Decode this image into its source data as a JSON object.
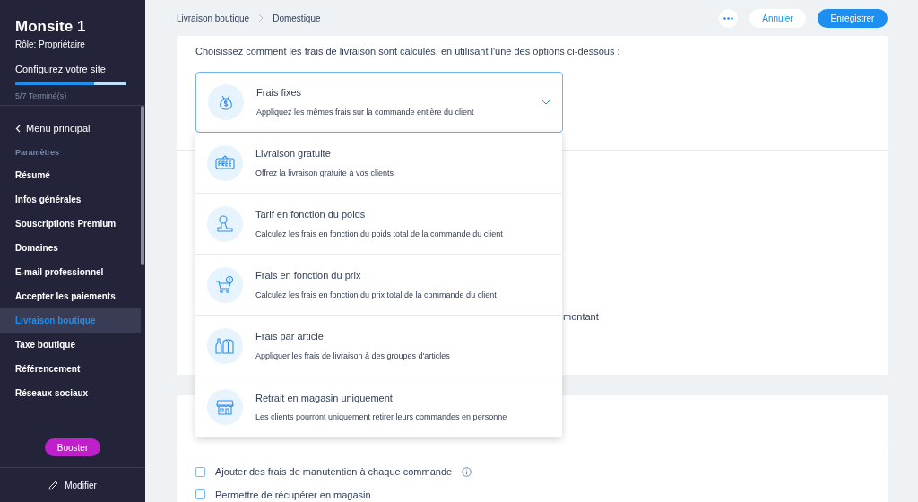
{
  "sidebar": {
    "site_name": "Monsite 1",
    "role": "Rôle: Propriétaire",
    "setup": {
      "label": "Configurez votre site",
      "level": 0.71,
      "progress": "5/7 Terminé(s)"
    },
    "back": "Menu principal",
    "section": "Paramètres",
    "items": [
      {
        "label": "Résumé",
        "selected": false
      },
      {
        "label": "Infos générales",
        "selected": false
      },
      {
        "label": "Souscriptions Premium",
        "selected": false
      },
      {
        "label": "Domaines",
        "selected": false
      },
      {
        "label": "E-mail professionnel",
        "selected": false
      },
      {
        "label": "Accepter les paiements",
        "selected": false
      },
      {
        "label": "Livraison boutique",
        "selected": true
      },
      {
        "label": "Taxe boutique",
        "selected": false
      },
      {
        "label": "Référencement",
        "selected": false
      },
      {
        "label": "Réseaux sociaux",
        "selected": false
      }
    ],
    "booster": "Booster",
    "edit": "Modifier"
  },
  "breadcrumb": [
    "Livraison boutique",
    "Domestique"
  ],
  "header_buttons": {
    "cancel": "Annuler",
    "save": "Enregistrer"
  },
  "intro": "Choisissez comment les frais de livraison sont calculés, en utilisant l'une des options ci-dessous :",
  "rate_select": {
    "title": "Frais fixes",
    "description": "Appliquez les mêmes frais sur la commande entière du client",
    "expanded": true
  },
  "options": [
    {
      "title": "Livraison gratuite",
      "description": "Offrez la livraison gratuite à vos clients"
    },
    {
      "title": "Tarif en fonction du poids",
      "description": "Calculez les frais en fonction du poids total de la commande du client"
    },
    {
      "title": "Frais en fonction du prix",
      "description": "Calculez les frais en fonction du prix total de la commande du client"
    },
    {
      "title": "Frais par article",
      "description": "Appliquer les frais de livraison à des groupes d'articles"
    },
    {
      "title": "Retrait en magasin uniquement",
      "description": "Les clients pourront uniquement retirer leurs commandes en personne"
    }
  ],
  "partial_text": "montant",
  "checkboxes": [
    {
      "label": "Ajouter des frais de manutention à chaque commande",
      "checked": false,
      "info": true
    },
    {
      "label": "Permettre de récupérer en magasin",
      "checked": false,
      "info": false
    }
  ]
}
